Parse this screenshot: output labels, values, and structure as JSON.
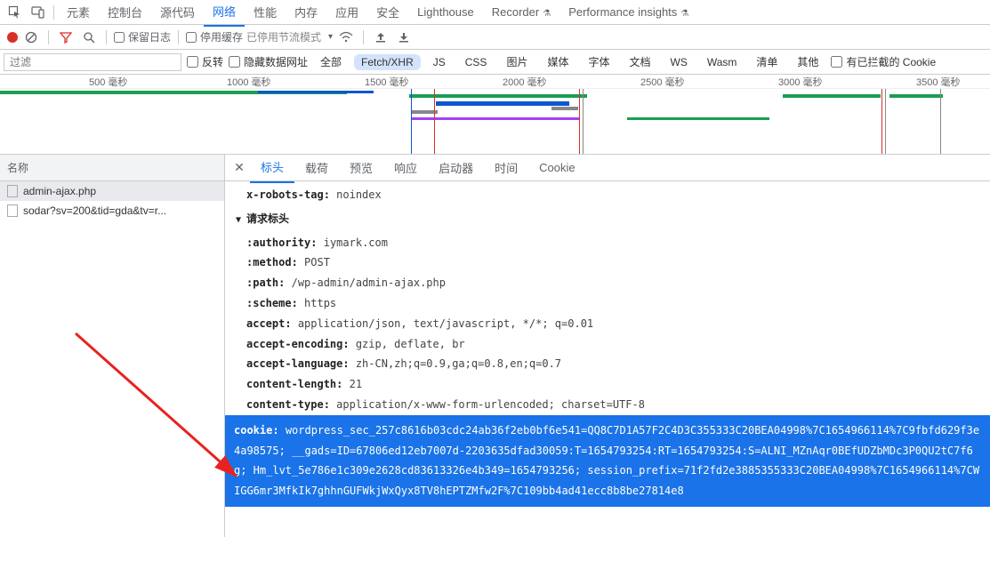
{
  "topTabs": {
    "inspect": "",
    "device": "",
    "elements": "元素",
    "console": "控制台",
    "sources": "源代码",
    "network": "网络",
    "performance": "性能",
    "memory": "内存",
    "application": "应用",
    "security": "安全",
    "lighthouse": "Lighthouse",
    "recorder": "Recorder",
    "perfInsights": "Performance insights"
  },
  "toolbar2": {
    "preserveLog": "保留日志",
    "disableCache": "停用缓存",
    "throttling": "已停用节流模式"
  },
  "filterRow": {
    "filterPlaceholder": "过滤",
    "invert": "反转",
    "hideData": "隐藏数据网址",
    "all": "全部",
    "fetchXhr": "Fetch/XHR",
    "js": "JS",
    "css": "CSS",
    "img": "图片",
    "media": "媒体",
    "font": "字体",
    "doc": "文档",
    "ws": "WS",
    "wasm": "Wasm",
    "manifest": "清单",
    "other": "其他",
    "blockedCookies": "有已拦截的 Cookie"
  },
  "timeline": {
    "ticks": [
      "500 毫秒",
      "1000 毫秒",
      "1500 毫秒",
      "2000 毫秒",
      "2500 毫秒",
      "3000 毫秒",
      "3500 毫秒"
    ]
  },
  "sidebar": {
    "header": "名称",
    "items": [
      "admin-ajax.php",
      "sodar?sv=200&tid=gda&tv=r..."
    ]
  },
  "detailsTabs": {
    "headers": "标头",
    "payload": "载荷",
    "preview": "预览",
    "response": "响应",
    "initiator": "启动器",
    "timing": "时间",
    "cookies": "Cookie"
  },
  "headers": {
    "xrobots": {
      "name": "x-robots-tag:",
      "value": "noindex"
    },
    "sectionRequest": "请求标头",
    "authority": {
      "name": ":authority:",
      "value": "iymark.com"
    },
    "method": {
      "name": ":method:",
      "value": "POST"
    },
    "path": {
      "name": ":path:",
      "value": "/wp-admin/admin-ajax.php"
    },
    "scheme": {
      "name": ":scheme:",
      "value": "https"
    },
    "accept": {
      "name": "accept:",
      "value": "application/json, text/javascript, */*; q=0.01"
    },
    "acceptEncoding": {
      "name": "accept-encoding:",
      "value": "gzip, deflate, br"
    },
    "acceptLanguage": {
      "name": "accept-language:",
      "value": "zh-CN,zh;q=0.9,ga;q=0.8,en;q=0.7"
    },
    "contentLength": {
      "name": "content-length:",
      "value": "21"
    },
    "contentType": {
      "name": "content-type:",
      "value": "application/x-www-form-urlencoded; charset=UTF-8"
    },
    "cookie": {
      "name": "cookie:",
      "value": "wordpress_sec_257c8616b03cdc24ab36f2eb0bf6e541=QQ8C7D1A57F2C4D3C355333C20BEA04998%7C1654966114%7C9fbfd629f3e4a98575; __gads=ID=67806ed12eb7007d-2203635dfad30059:T=1654793254:RT=1654793254:S=ALNI_MZnAqr0BEfUDZbMDc3P0QU2tC7f6g; Hm_lvt_5e786e1c309e2628cd83613326e4b349=1654793256; session_prefix=71f2fd2e3885355333C20BEA04998%7C1654966114%7CWIGG6mr3MfkIk7ghhnGUFWkjWxQyx8TV8hEPTZMfw2F%7C109bb4ad41ecc8b8be27814e8"
    }
  }
}
